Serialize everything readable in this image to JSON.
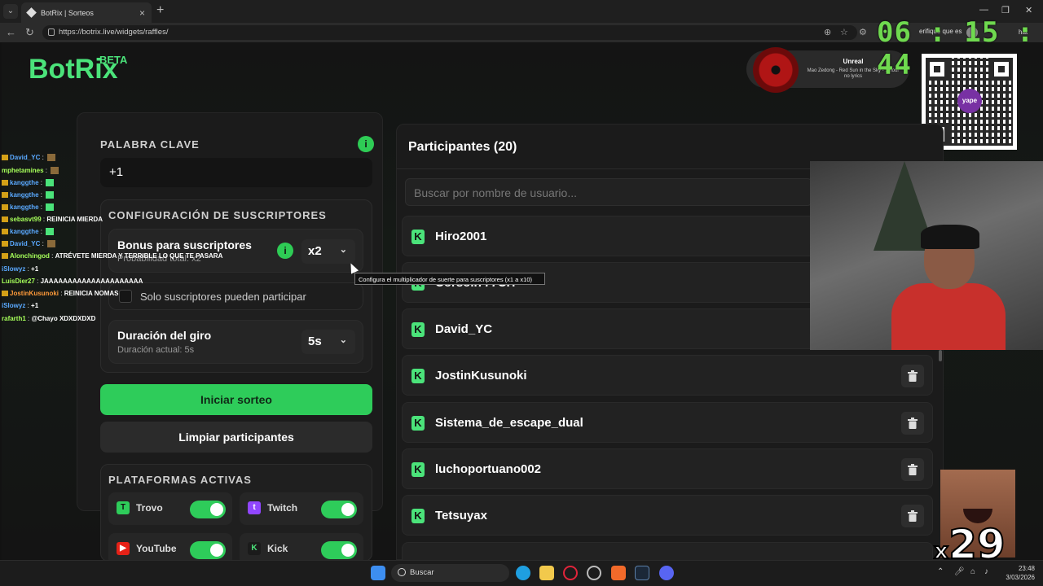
{
  "browser": {
    "tab_title": "BotRix | Sorteos",
    "url": "https://botrix.live/widgets/raffles/",
    "verify_text": "erifique que es",
    "chat_label": "hat"
  },
  "overlay": {
    "timer": "06 : 15 : 44",
    "multiplier_x": "x",
    "multiplier_num": "29"
  },
  "app": {
    "logo": "BotRix",
    "beta": "BETA"
  },
  "music": {
    "title": "Unreal",
    "subtitle": "Mao Zedong - Red Sun in the Sky - 1 hour no lyrics"
  },
  "qr": {
    "label": "yape"
  },
  "left": {
    "keyword_title": "PALABRA CLAVE",
    "keyword_value": "+1",
    "subs_title": "CONFIGURACIÓN DE SUSCRIPTORES",
    "bonus_label": "Bonus para suscriptores",
    "bonus_sub": "Probabilidad total: x2",
    "bonus_value": "x2",
    "subs_only_label": "Solo suscriptores pueden participar",
    "duration_label": "Duración del giro",
    "duration_sub": "Duración actual: 5s",
    "duration_value": "5s",
    "start_button": "Iniciar sorteo",
    "clear_button": "Limpiar participantes",
    "platforms_title": "PLATAFORMAS ACTIVAS",
    "platforms": [
      "Trovo",
      "Twitch",
      "YouTube",
      "Kick"
    ]
  },
  "tooltip": "Configura el multiplicador de suerte para suscriptores (x1 a x10)",
  "right": {
    "title": "Participantes (20)",
    "search_placeholder": "Buscar por nombre de usuario...",
    "participants": [
      "Hiro2001",
      "Corsoll777CH",
      "David_YC",
      "JostinKusunoki",
      "Sistema_de_escape_dual",
      "luchoportuano002",
      "Tetsuyax"
    ]
  },
  "chat": [
    {
      "user": "David_YC",
      "msg": "",
      "color": "#5aa9ff"
    },
    {
      "user": "mphetamines",
      "msg": "",
      "color": "#a6ff5a"
    },
    {
      "user": "kanggthe",
      "msg": "",
      "color": "#5aa9ff"
    },
    {
      "user": "kanggthe",
      "msg": "",
      "color": "#5aa9ff"
    },
    {
      "user": "kanggthe",
      "msg": "",
      "color": "#5aa9ff"
    },
    {
      "user": "sebasvt99",
      "msg": "REINICIA MIERDA",
      "color": "#a6ff5a"
    },
    {
      "user": "kanggthe",
      "msg": "",
      "color": "#5aa9ff"
    },
    {
      "user": "David_YC",
      "msg": "",
      "color": "#5aa9ff"
    },
    {
      "user": "Alonchingod",
      "msg": "ATRÉVETE MIERDA Y TERRIBLE LO QUE TE PASARA",
      "color": "#a6ff5a"
    },
    {
      "user": "iSlowyz",
      "msg": "+1",
      "color": "#5aa9ff"
    },
    {
      "user": "LuisDier27",
      "msg": "JAAAAAAAAAAAAAAAAAAAAA",
      "color": "#a6ff5a"
    },
    {
      "user": "JostinKusunoki",
      "msg": "REINICIA NOMAS",
      "color": "#ff9a3a"
    },
    {
      "user": "iSlowyz",
      "msg": "+1",
      "color": "#5aa9ff"
    },
    {
      "user": "rafarth1",
      "msg": "@Chayo XDXDXDXD",
      "color": "#a6ff5a"
    }
  ],
  "taskbar": {
    "search": "Buscar",
    "time": "23:48",
    "date": "3/03/2026"
  }
}
